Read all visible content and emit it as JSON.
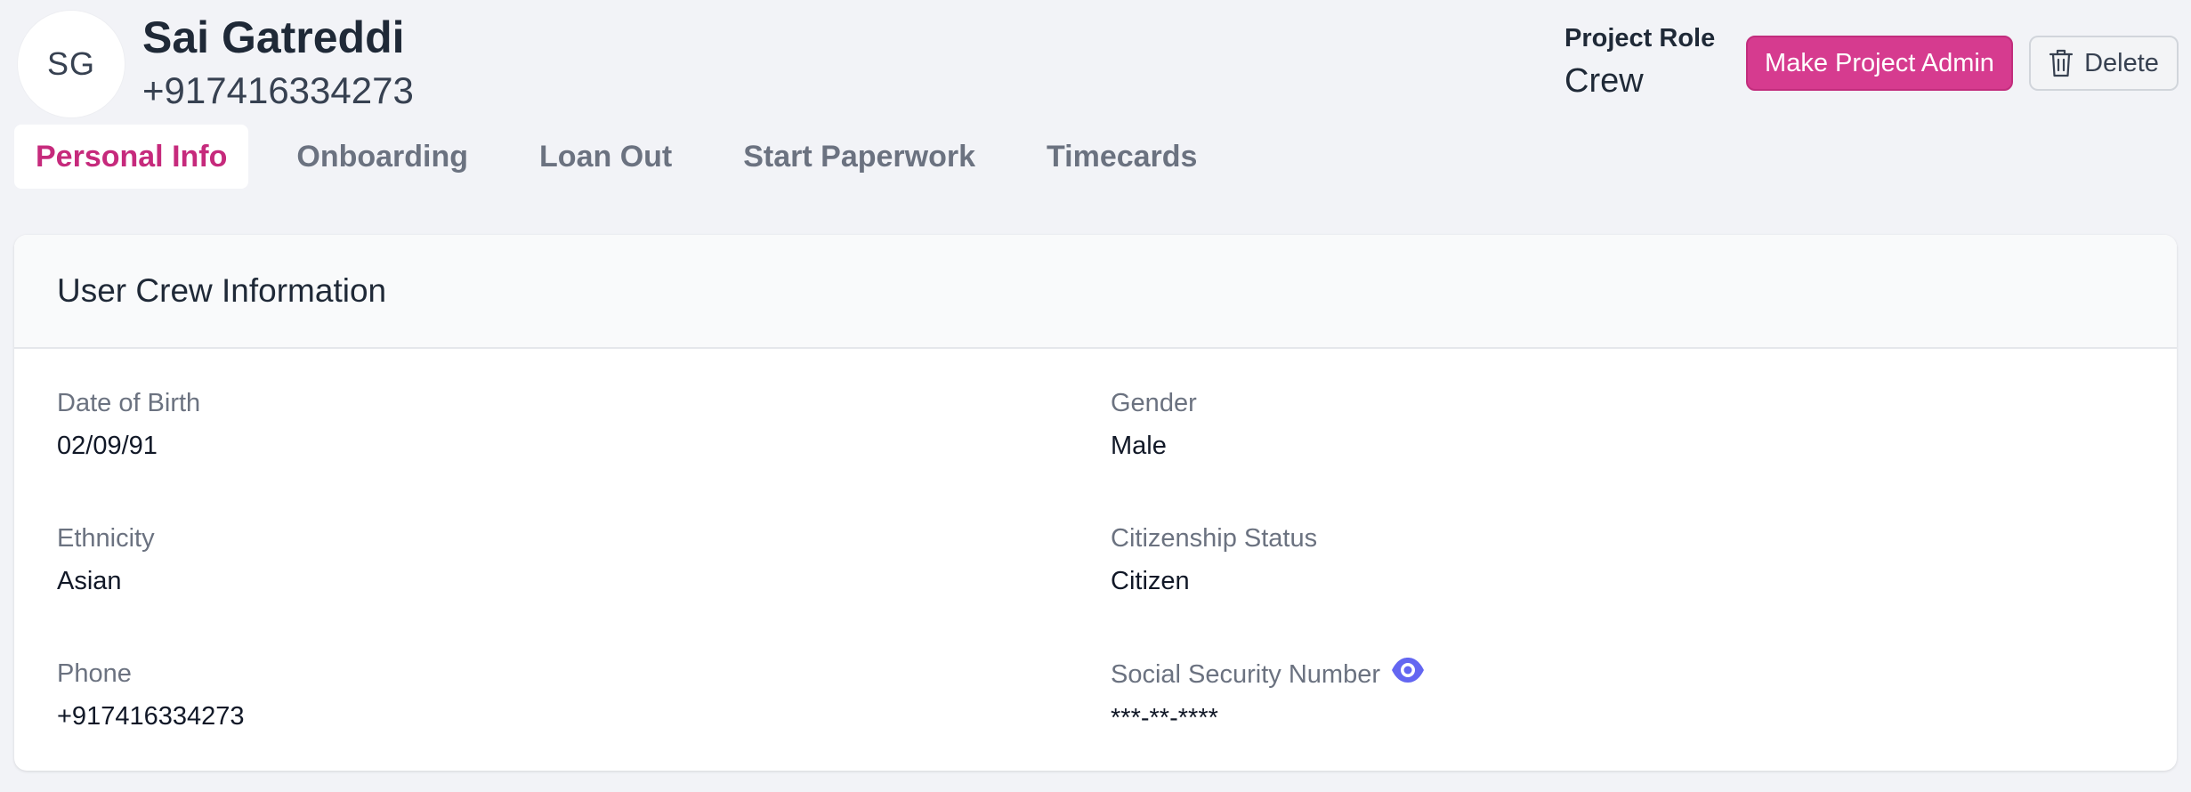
{
  "header": {
    "avatar_initials": "SG",
    "user_name": "Sai Gatreddi",
    "user_phone": "+917416334273",
    "project_role_label": "Project Role",
    "project_role_value": "Crew",
    "make_admin_label": "Make Project Admin",
    "delete_label": "Delete"
  },
  "tabs": [
    {
      "label": "Personal Info",
      "active": true
    },
    {
      "label": "Onboarding",
      "active": false
    },
    {
      "label": "Loan Out",
      "active": false
    },
    {
      "label": "Start Paperwork",
      "active": false
    },
    {
      "label": "Timecards",
      "active": false
    }
  ],
  "card": {
    "title": "User Crew Information",
    "fields": {
      "dob": {
        "label": "Date of Birth",
        "value": "02/09/91"
      },
      "gender": {
        "label": "Gender",
        "value": "Male"
      },
      "ethnicity": {
        "label": "Ethnicity",
        "value": "Asian"
      },
      "citizenship": {
        "label": "Citizenship Status",
        "value": "Citizen"
      },
      "phone": {
        "label": "Phone",
        "value": "+917416334273"
      },
      "ssn": {
        "label": "Social Security Number",
        "value": "***-**-****"
      }
    }
  },
  "colors": {
    "accent": "#c62a7c",
    "primary_button": "#d63b8f",
    "eye_icon": "#6366f1"
  }
}
